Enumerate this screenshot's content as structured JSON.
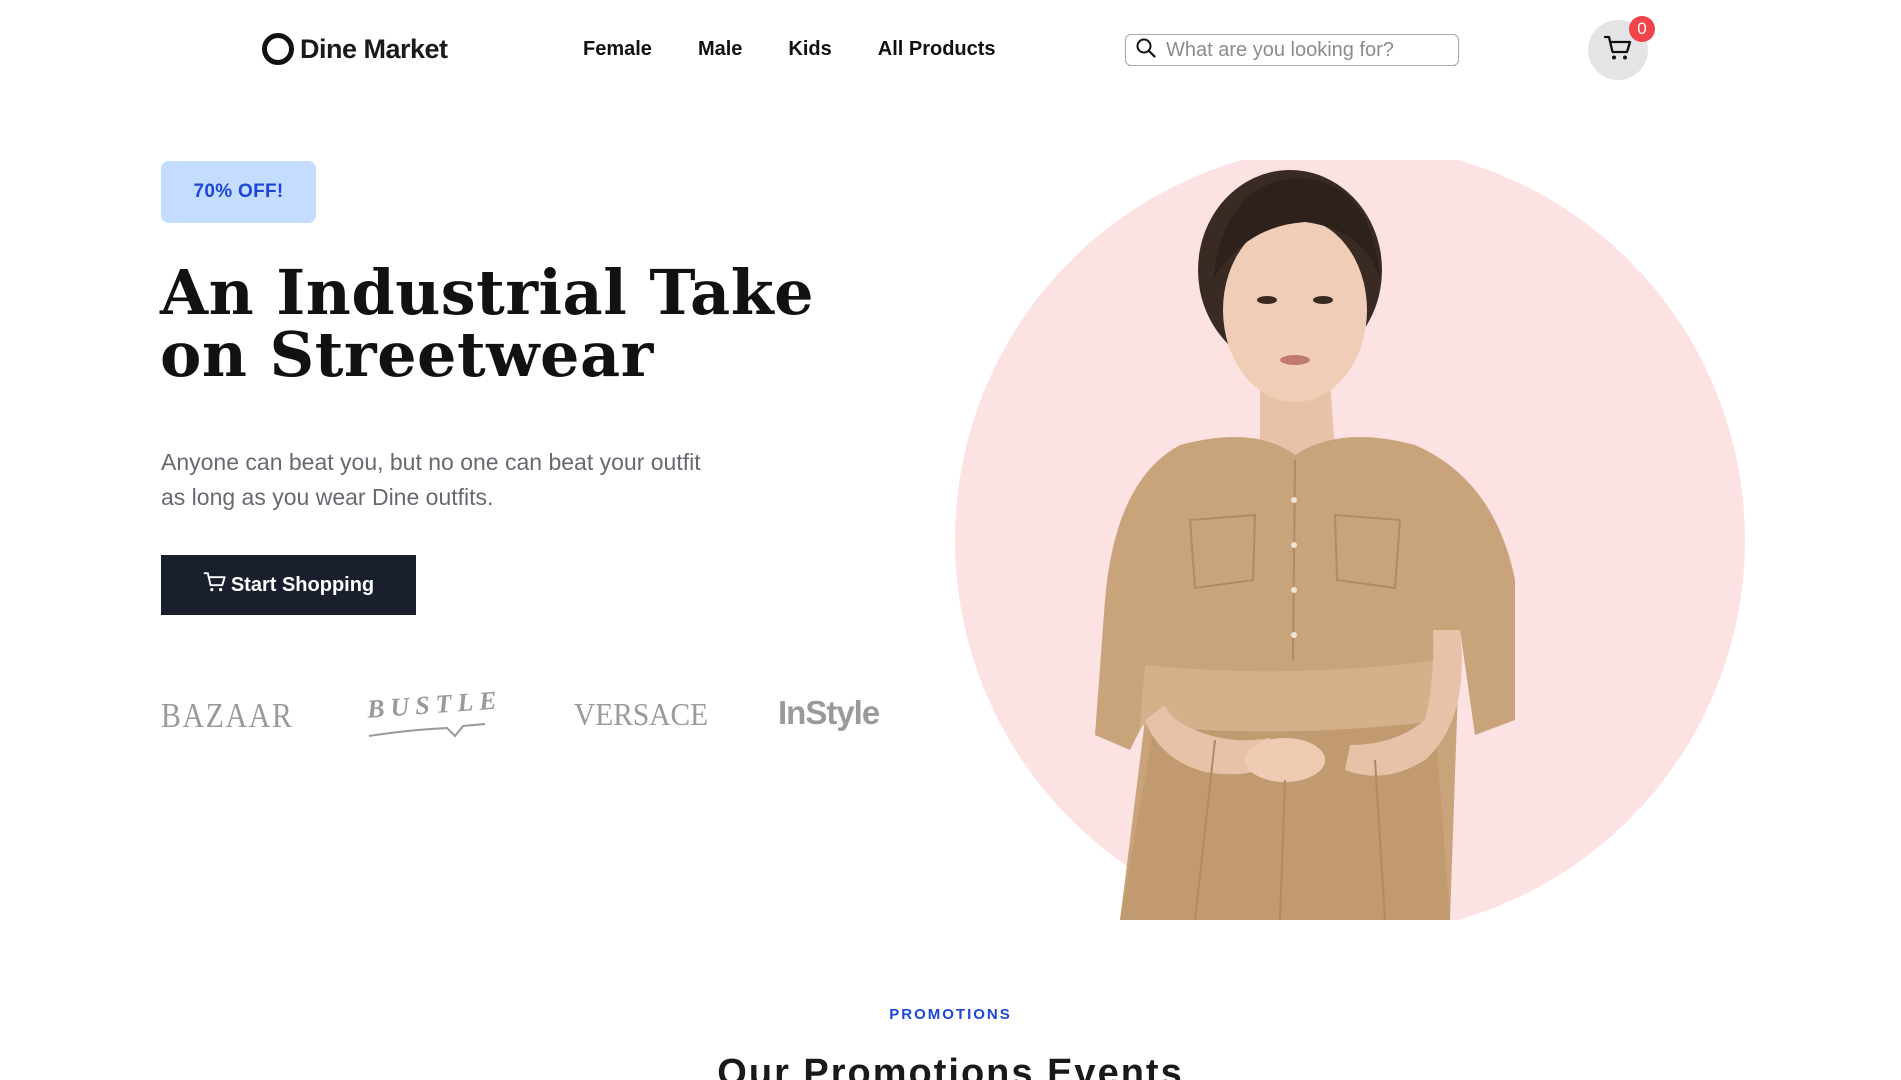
{
  "header": {
    "logo_text": "Dine Market",
    "nav": [
      {
        "label": "Female"
      },
      {
        "label": "Male"
      },
      {
        "label": "Kids"
      },
      {
        "label": "All Products"
      }
    ],
    "search": {
      "placeholder": "What are you looking for?",
      "value": ""
    },
    "cart": {
      "count": "0",
      "icon": "cart-icon"
    }
  },
  "hero": {
    "badge": "70% OFF!",
    "title": "An Industrial Take on Streetwear",
    "subtitle": "Anyone can beat you, but no one can beat your outfit as long as you wear Dine outfits.",
    "cta_label": "Start Shopping",
    "brands": [
      "BAZAAR",
      "BUSTLE",
      "VERSACE",
      "InStyle"
    ],
    "colors": {
      "badge_bg": "#c3dcff",
      "badge_text": "#1e46d6",
      "cta_bg": "#1a1f2e",
      "circle": "#fde2e4",
      "dress": "#c9a47b"
    }
  },
  "promotions": {
    "eyebrow": "PROMOTIONS",
    "title": "Our Promotions Events"
  }
}
